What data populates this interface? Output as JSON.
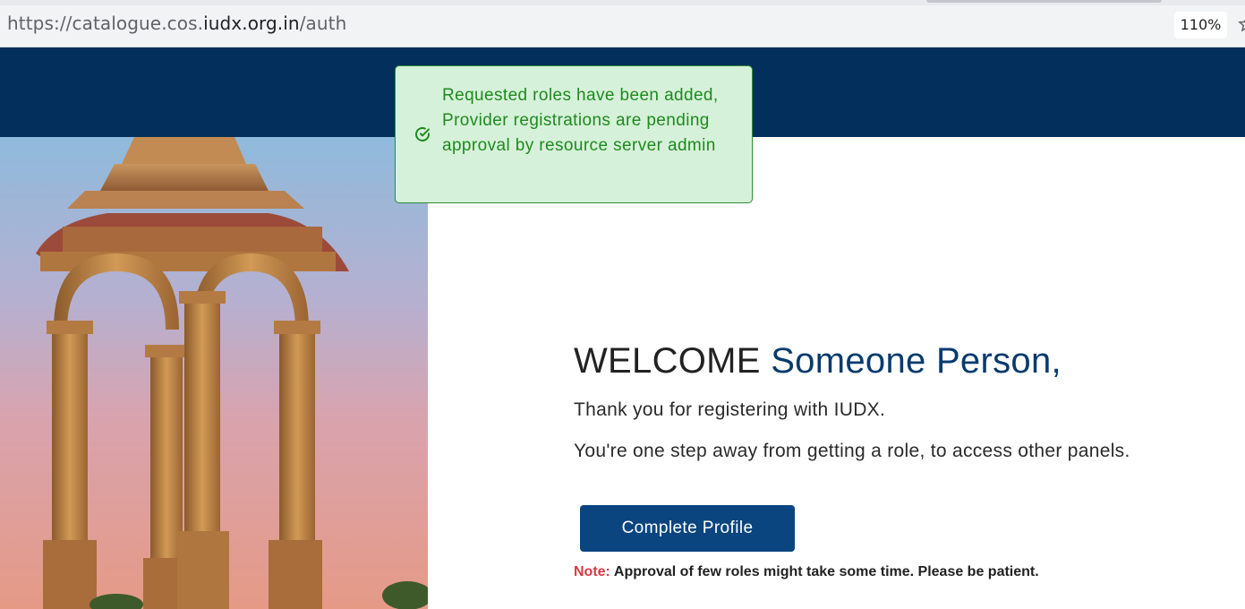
{
  "browser": {
    "url_prefix": "https://catalogue.cos.",
    "url_host": "iudx.org.in",
    "url_path": "/auth",
    "zoom": "110%"
  },
  "toast": {
    "icon": "check-circle-icon",
    "message": "Requested roles have been added, Provider registrations are pending approval by resource server admin",
    "color": "#1e8a1f"
  },
  "welcome": {
    "greeting": "WELCOME",
    "name": "Someone Person,",
    "line1": "Thank you for registering with IUDX.",
    "line2": "You're one step away from getting a role, to access other panels."
  },
  "actions": {
    "complete_profile": "Complete Profile"
  },
  "note": {
    "label": "Note:",
    "text": "Approval of few roles might take some time. Please be patient."
  },
  "colors": {
    "header": "#022f5b",
    "button": "#0b4580",
    "name_accent": "#073b6e",
    "note_label": "#d23d45"
  }
}
